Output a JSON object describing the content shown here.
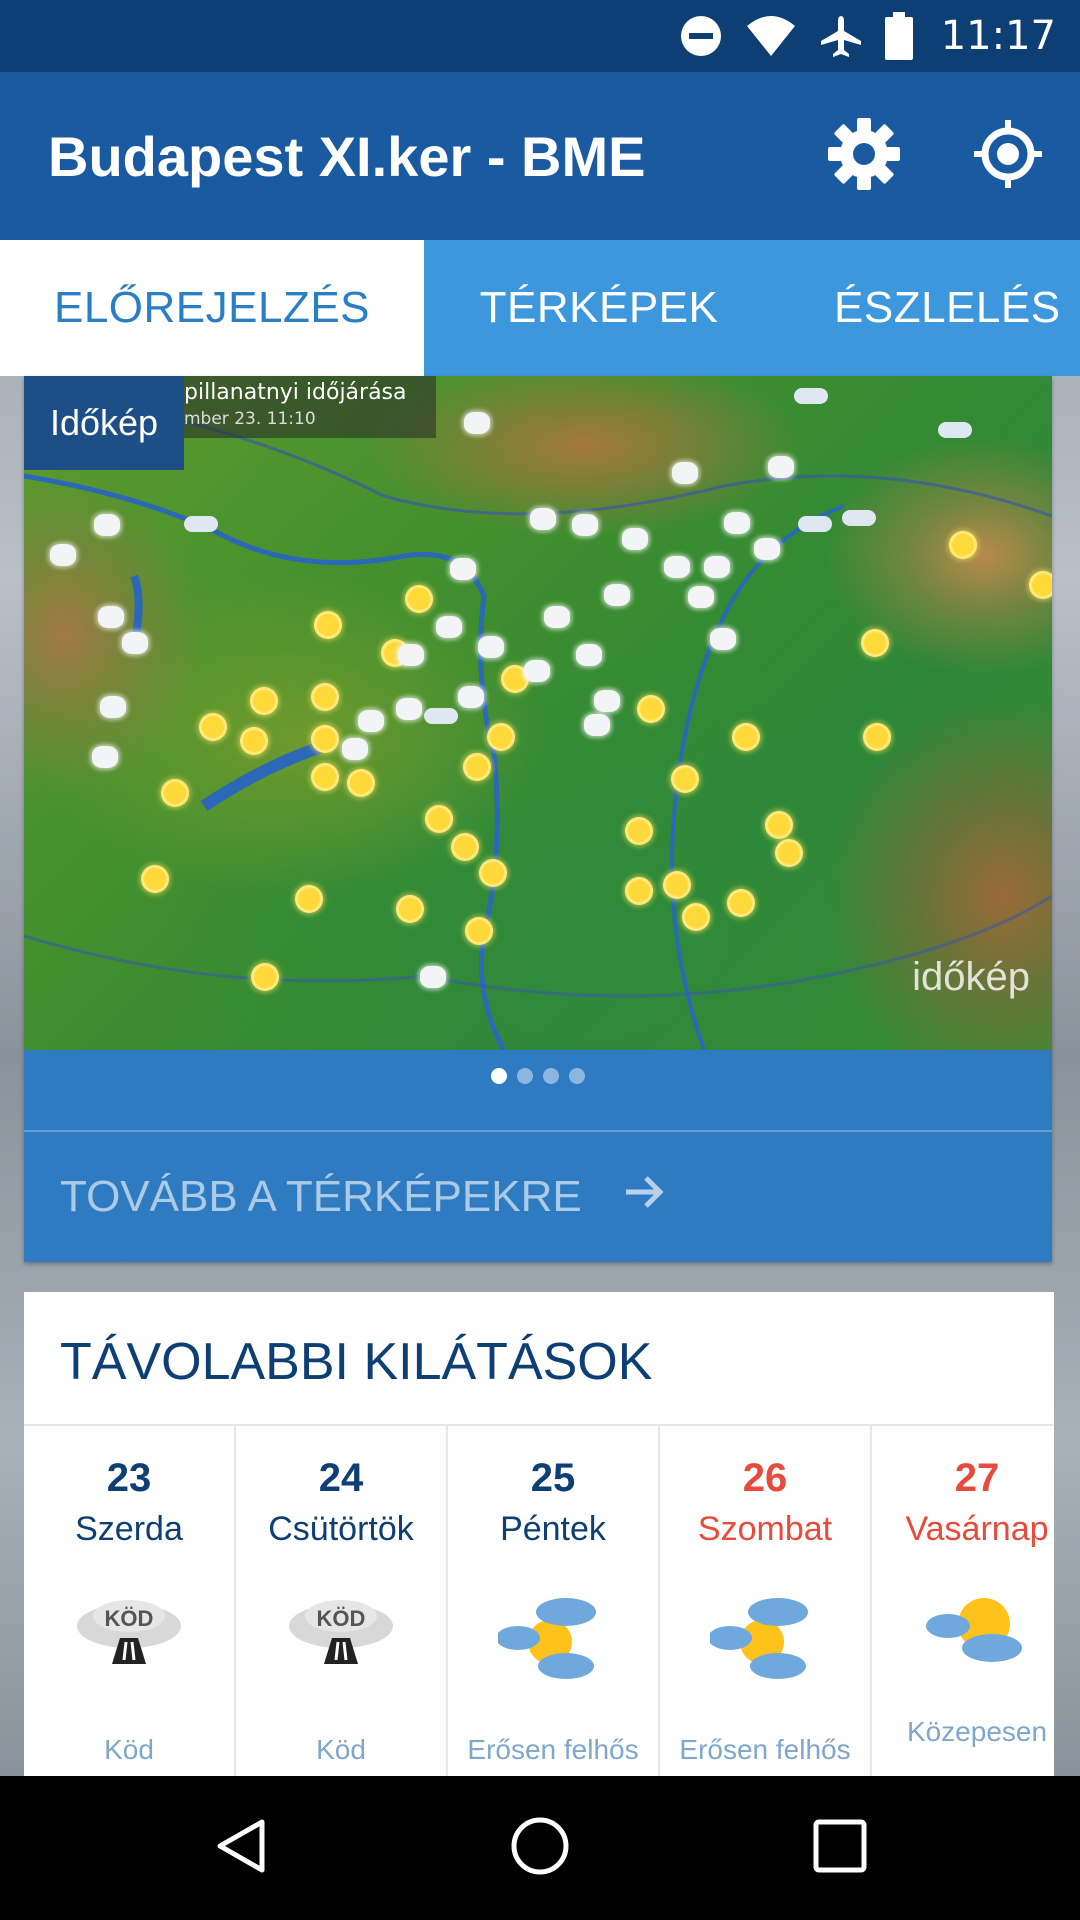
{
  "status_bar": {
    "time": "11:17",
    "icons": [
      "do-not-disturb-icon",
      "wifi-icon",
      "airplane-icon",
      "battery-icon"
    ]
  },
  "app_bar": {
    "title": "Budapest XI.ker - BME",
    "icons": [
      "gear-icon",
      "location-icon"
    ]
  },
  "tabs": [
    {
      "label": "ELŐREJELZÉS",
      "active": true
    },
    {
      "label": "TÉRKÉPEK",
      "active": false
    },
    {
      "label": "ÉSZLELÉS",
      "active": false
    }
  ],
  "map_card": {
    "badge": "Időkép",
    "caption_line1": "pillanatnyi időjárása",
    "caption_line2": "mber 23. 11:10",
    "watermark": "időkép",
    "page_count": 4,
    "active_page": 1,
    "more_link": "TOVÁBB A TÉRKÉPEKRE",
    "more_link_icon": "arrow-right-icon"
  },
  "forecast": {
    "title": "TÁVOLABBI KILÁTÁSOK",
    "days": [
      {
        "num": "23",
        "name": "Szerda",
        "icon": "fog-icon",
        "icon_text": "KÖD",
        "desc": "Köd",
        "weekend": false
      },
      {
        "num": "24",
        "name": "Csütörtök",
        "icon": "fog-icon",
        "icon_text": "KÖD",
        "desc": "Köd",
        "weekend": false
      },
      {
        "num": "25",
        "name": "Péntek",
        "icon": "mostly-cloudy-icon",
        "desc": "Erősen felhős",
        "weekend": false
      },
      {
        "num": "26",
        "name": "Szombat",
        "icon": "mostly-cloudy-icon",
        "desc": "Erősen felhős",
        "weekend": true
      },
      {
        "num": "27",
        "name": "Vasárnap",
        "icon": "partly-cloudy-icon",
        "desc": "Közepesen",
        "weekend": true
      }
    ]
  },
  "nav_bar": {
    "icons": [
      "back-icon",
      "home-icon",
      "recents-icon"
    ]
  },
  "colors": {
    "status_bar": "#0d3e74",
    "app_bar": "#1a5aa0",
    "tab_bar": "#3d97dc",
    "accent": "#2a7ec4",
    "weekend": "#e84a3c"
  }
}
